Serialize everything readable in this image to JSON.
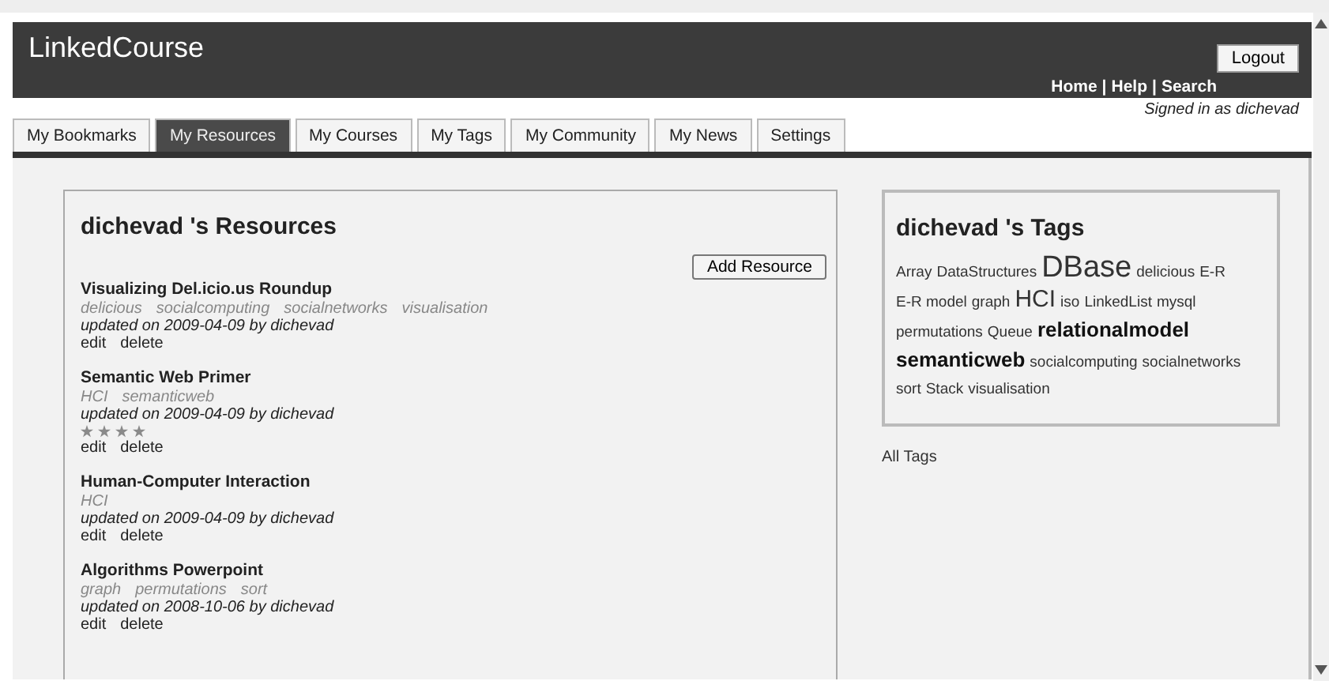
{
  "header": {
    "logo": "LinkedCourse",
    "logout": "Logout",
    "nav": [
      {
        "label": "Home"
      },
      {
        "label": "Help"
      },
      {
        "label": "Search"
      }
    ],
    "nav_separator": "|",
    "signed_in": "Signed in as dichevad"
  },
  "tabs": [
    {
      "label": "My Bookmarks",
      "selected": false
    },
    {
      "label": "My Resources",
      "selected": true
    },
    {
      "label": "My Courses",
      "selected": false
    },
    {
      "label": "My Tags",
      "selected": false
    },
    {
      "label": "My Community",
      "selected": false
    },
    {
      "label": "My News",
      "selected": false
    },
    {
      "label": "Settings",
      "selected": false
    }
  ],
  "resources": {
    "title": "dichevad 's Resources",
    "add_button": "Add Resource",
    "items": [
      {
        "title": "Visualizing Del.icio.us Roundup",
        "tags": [
          "delicious",
          "socialcomputing",
          "socialnetworks",
          "visualisation"
        ],
        "updated": "updated on 2009-04-09 by dichevad",
        "actions": [
          "edit",
          "delete"
        ]
      },
      {
        "title": "Semantic Web Primer",
        "tags": [
          "HCI",
          "semanticweb"
        ],
        "updated": "updated on 2009-04-09 by dichevad",
        "stars": 4,
        "actions": [
          "edit",
          "delete"
        ]
      },
      {
        "title": "Human-Computer Interaction",
        "tags": [
          "HCI"
        ],
        "updated": "updated on 2009-04-09 by dichevad",
        "actions": [
          "edit",
          "delete"
        ]
      },
      {
        "title": "Algorithms Powerpoint",
        "tags": [
          "graph",
          "permutations",
          "sort"
        ],
        "updated": "updated on 2008-10-06 by dichevad",
        "actions": [
          "edit",
          "delete"
        ]
      }
    ]
  },
  "tag_cloud": {
    "title": "dichevad 's Tags",
    "tags": [
      {
        "label": "Array",
        "kind": "small"
      },
      {
        "label": "DataStructures",
        "kind": "small"
      },
      {
        "label": "DBase",
        "kind": "huge"
      },
      {
        "label": "delicious",
        "kind": "small"
      },
      {
        "label": "E-R",
        "kind": "small"
      },
      {
        "label": "E-R model",
        "kind": "small"
      },
      {
        "label": "graph",
        "kind": "small"
      },
      {
        "label": "HCI",
        "kind": "large"
      },
      {
        "label": "iso",
        "kind": "small"
      },
      {
        "label": "LinkedList",
        "kind": "small"
      },
      {
        "label": "mysql",
        "kind": "small"
      },
      {
        "label": "permutations",
        "kind": "small"
      },
      {
        "label": "Queue",
        "kind": "small"
      },
      {
        "label": "relationalmodel",
        "kind": "bold"
      },
      {
        "label": "semanticweb",
        "kind": "bold"
      },
      {
        "label": "socialcomputing",
        "kind": "small"
      },
      {
        "label": "socialnetworks",
        "kind": "small"
      },
      {
        "label": "sort",
        "kind": "small"
      },
      {
        "label": "Stack",
        "kind": "small"
      },
      {
        "label": "visualisation",
        "kind": "small"
      }
    ],
    "all_tags": "All Tags"
  }
}
